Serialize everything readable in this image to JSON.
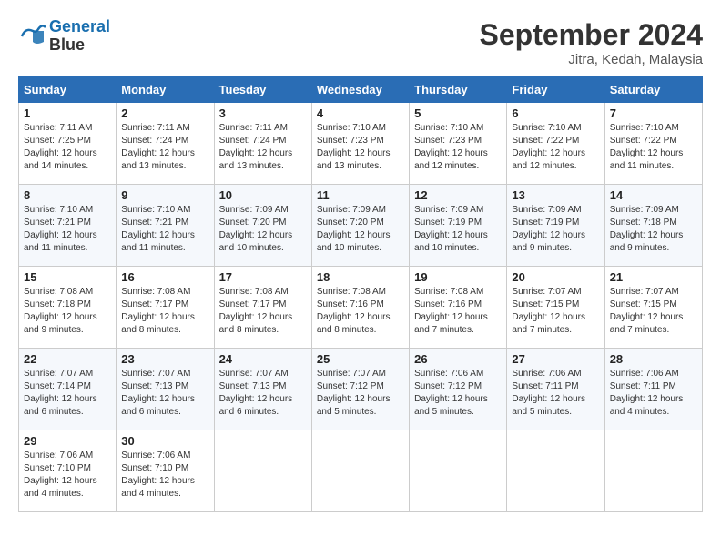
{
  "header": {
    "logo_line1": "General",
    "logo_line2": "Blue",
    "title": "September 2024",
    "subtitle": "Jitra, Kedah, Malaysia"
  },
  "days_of_week": [
    "Sunday",
    "Monday",
    "Tuesday",
    "Wednesday",
    "Thursday",
    "Friday",
    "Saturday"
  ],
  "weeks": [
    [
      {
        "day": "1",
        "info": "Sunrise: 7:11 AM\nSunset: 7:25 PM\nDaylight: 12 hours\nand 14 minutes."
      },
      {
        "day": "2",
        "info": "Sunrise: 7:11 AM\nSunset: 7:24 PM\nDaylight: 12 hours\nand 13 minutes."
      },
      {
        "day": "3",
        "info": "Sunrise: 7:11 AM\nSunset: 7:24 PM\nDaylight: 12 hours\nand 13 minutes."
      },
      {
        "day": "4",
        "info": "Sunrise: 7:10 AM\nSunset: 7:23 PM\nDaylight: 12 hours\nand 13 minutes."
      },
      {
        "day": "5",
        "info": "Sunrise: 7:10 AM\nSunset: 7:23 PM\nDaylight: 12 hours\nand 12 minutes."
      },
      {
        "day": "6",
        "info": "Sunrise: 7:10 AM\nSunset: 7:22 PM\nDaylight: 12 hours\nand 12 minutes."
      },
      {
        "day": "7",
        "info": "Sunrise: 7:10 AM\nSunset: 7:22 PM\nDaylight: 12 hours\nand 11 minutes."
      }
    ],
    [
      {
        "day": "8",
        "info": "Sunrise: 7:10 AM\nSunset: 7:21 PM\nDaylight: 12 hours\nand 11 minutes."
      },
      {
        "day": "9",
        "info": "Sunrise: 7:10 AM\nSunset: 7:21 PM\nDaylight: 12 hours\nand 11 minutes."
      },
      {
        "day": "10",
        "info": "Sunrise: 7:09 AM\nSunset: 7:20 PM\nDaylight: 12 hours\nand 10 minutes."
      },
      {
        "day": "11",
        "info": "Sunrise: 7:09 AM\nSunset: 7:20 PM\nDaylight: 12 hours\nand 10 minutes."
      },
      {
        "day": "12",
        "info": "Sunrise: 7:09 AM\nSunset: 7:19 PM\nDaylight: 12 hours\nand 10 minutes."
      },
      {
        "day": "13",
        "info": "Sunrise: 7:09 AM\nSunset: 7:19 PM\nDaylight: 12 hours\nand 9 minutes."
      },
      {
        "day": "14",
        "info": "Sunrise: 7:09 AM\nSunset: 7:18 PM\nDaylight: 12 hours\nand 9 minutes."
      }
    ],
    [
      {
        "day": "15",
        "info": "Sunrise: 7:08 AM\nSunset: 7:18 PM\nDaylight: 12 hours\nand 9 minutes."
      },
      {
        "day": "16",
        "info": "Sunrise: 7:08 AM\nSunset: 7:17 PM\nDaylight: 12 hours\nand 8 minutes."
      },
      {
        "day": "17",
        "info": "Sunrise: 7:08 AM\nSunset: 7:17 PM\nDaylight: 12 hours\nand 8 minutes."
      },
      {
        "day": "18",
        "info": "Sunrise: 7:08 AM\nSunset: 7:16 PM\nDaylight: 12 hours\nand 8 minutes."
      },
      {
        "day": "19",
        "info": "Sunrise: 7:08 AM\nSunset: 7:16 PM\nDaylight: 12 hours\nand 7 minutes."
      },
      {
        "day": "20",
        "info": "Sunrise: 7:07 AM\nSunset: 7:15 PM\nDaylight: 12 hours\nand 7 minutes."
      },
      {
        "day": "21",
        "info": "Sunrise: 7:07 AM\nSunset: 7:15 PM\nDaylight: 12 hours\nand 7 minutes."
      }
    ],
    [
      {
        "day": "22",
        "info": "Sunrise: 7:07 AM\nSunset: 7:14 PM\nDaylight: 12 hours\nand 6 minutes."
      },
      {
        "day": "23",
        "info": "Sunrise: 7:07 AM\nSunset: 7:13 PM\nDaylight: 12 hours\nand 6 minutes."
      },
      {
        "day": "24",
        "info": "Sunrise: 7:07 AM\nSunset: 7:13 PM\nDaylight: 12 hours\nand 6 minutes."
      },
      {
        "day": "25",
        "info": "Sunrise: 7:07 AM\nSunset: 7:12 PM\nDaylight: 12 hours\nand 5 minutes."
      },
      {
        "day": "26",
        "info": "Sunrise: 7:06 AM\nSunset: 7:12 PM\nDaylight: 12 hours\nand 5 minutes."
      },
      {
        "day": "27",
        "info": "Sunrise: 7:06 AM\nSunset: 7:11 PM\nDaylight: 12 hours\nand 5 minutes."
      },
      {
        "day": "28",
        "info": "Sunrise: 7:06 AM\nSunset: 7:11 PM\nDaylight: 12 hours\nand 4 minutes."
      }
    ],
    [
      {
        "day": "29",
        "info": "Sunrise: 7:06 AM\nSunset: 7:10 PM\nDaylight: 12 hours\nand 4 minutes."
      },
      {
        "day": "30",
        "info": "Sunrise: 7:06 AM\nSunset: 7:10 PM\nDaylight: 12 hours\nand 4 minutes."
      },
      null,
      null,
      null,
      null,
      null
    ]
  ]
}
